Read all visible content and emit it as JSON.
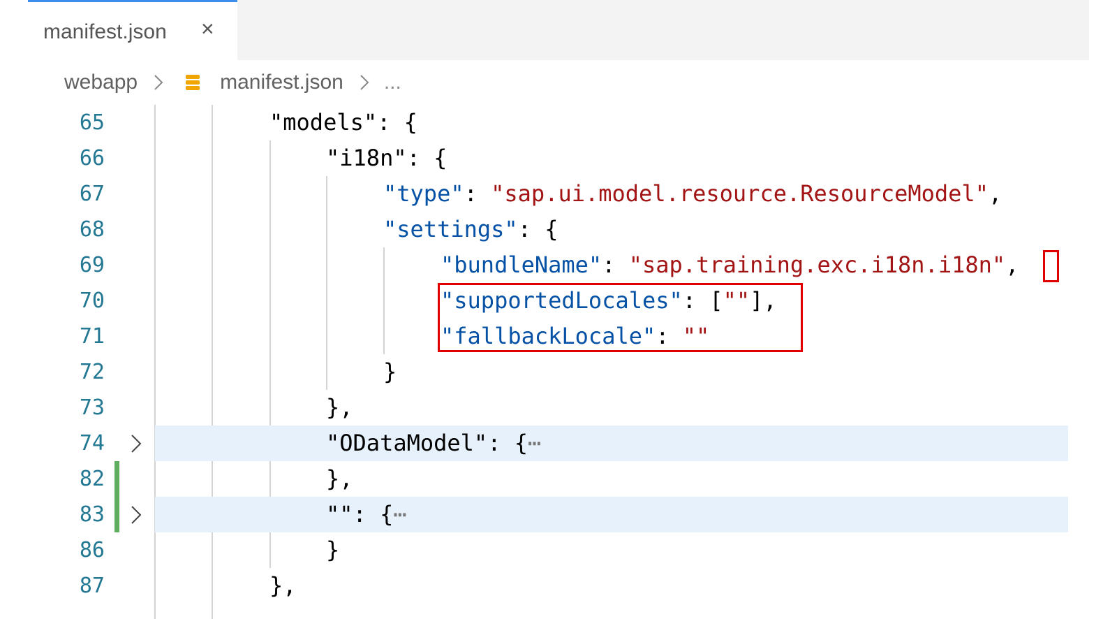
{
  "tab": {
    "label": "manifest.json",
    "close": "×"
  },
  "breadcrumb": {
    "folder": "webapp",
    "file": "manifest.json",
    "more": "..."
  },
  "colors": {
    "key": "#0451a5",
    "string": "#a31515",
    "highlight_box": "#e00000",
    "line_number": "#237893",
    "folded_line_bg": "#e6f1fb",
    "git_added": "#5fae5f"
  },
  "lines": [
    {
      "num": "65",
      "parts": [
        [
          "p",
          "\"models\": {"
        ]
      ]
    },
    {
      "num": "66",
      "parts": [
        [
          "p",
          "\"i18n\": {"
        ]
      ]
    },
    {
      "num": "67",
      "parts": [
        [
          "k",
          "\"type\""
        ],
        [
          "p",
          ": "
        ],
        [
          "s",
          "\"sap.ui.model.resource.ResourceModel\""
        ],
        [
          "p",
          ","
        ]
      ]
    },
    {
      "num": "68",
      "parts": [
        [
          "k",
          "\"settings\""
        ],
        [
          "p",
          ": {"
        ]
      ]
    },
    {
      "num": "69",
      "parts": [
        [
          "k",
          "\"bundleName\""
        ],
        [
          "p",
          ": "
        ],
        [
          "s",
          "\"sap.training.exc.i18n.i18n\""
        ],
        [
          "p",
          ","
        ]
      ]
    },
    {
      "num": "70",
      "parts": [
        [
          "k",
          "\"supportedLocales\""
        ],
        [
          "p",
          ": ["
        ],
        [
          "s",
          "\"\""
        ],
        [
          "p",
          "],"
        ]
      ]
    },
    {
      "num": "71",
      "parts": [
        [
          "k",
          "\"fallbackLocale\""
        ],
        [
          "p",
          ": "
        ],
        [
          "s",
          "\"\""
        ]
      ]
    },
    {
      "num": "72",
      "parts": [
        [
          "p",
          "}"
        ]
      ]
    },
    {
      "num": "73",
      "parts": [
        [
          "p",
          "},"
        ]
      ]
    },
    {
      "num": "74",
      "parts": [
        [
          "p",
          "\"ODataModel\": {"
        ],
        [
          "e",
          "⋯"
        ]
      ]
    },
    {
      "num": "82",
      "parts": [
        [
          "p",
          "},"
        ]
      ]
    },
    {
      "num": "83",
      "parts": [
        [
          "p",
          "\"\": {"
        ],
        [
          "e",
          "⋯"
        ]
      ]
    },
    {
      "num": "86",
      "parts": [
        [
          "p",
          "}"
        ]
      ]
    },
    {
      "num": "87",
      "parts": [
        [
          "p",
          "},"
        ]
      ]
    }
  ]
}
